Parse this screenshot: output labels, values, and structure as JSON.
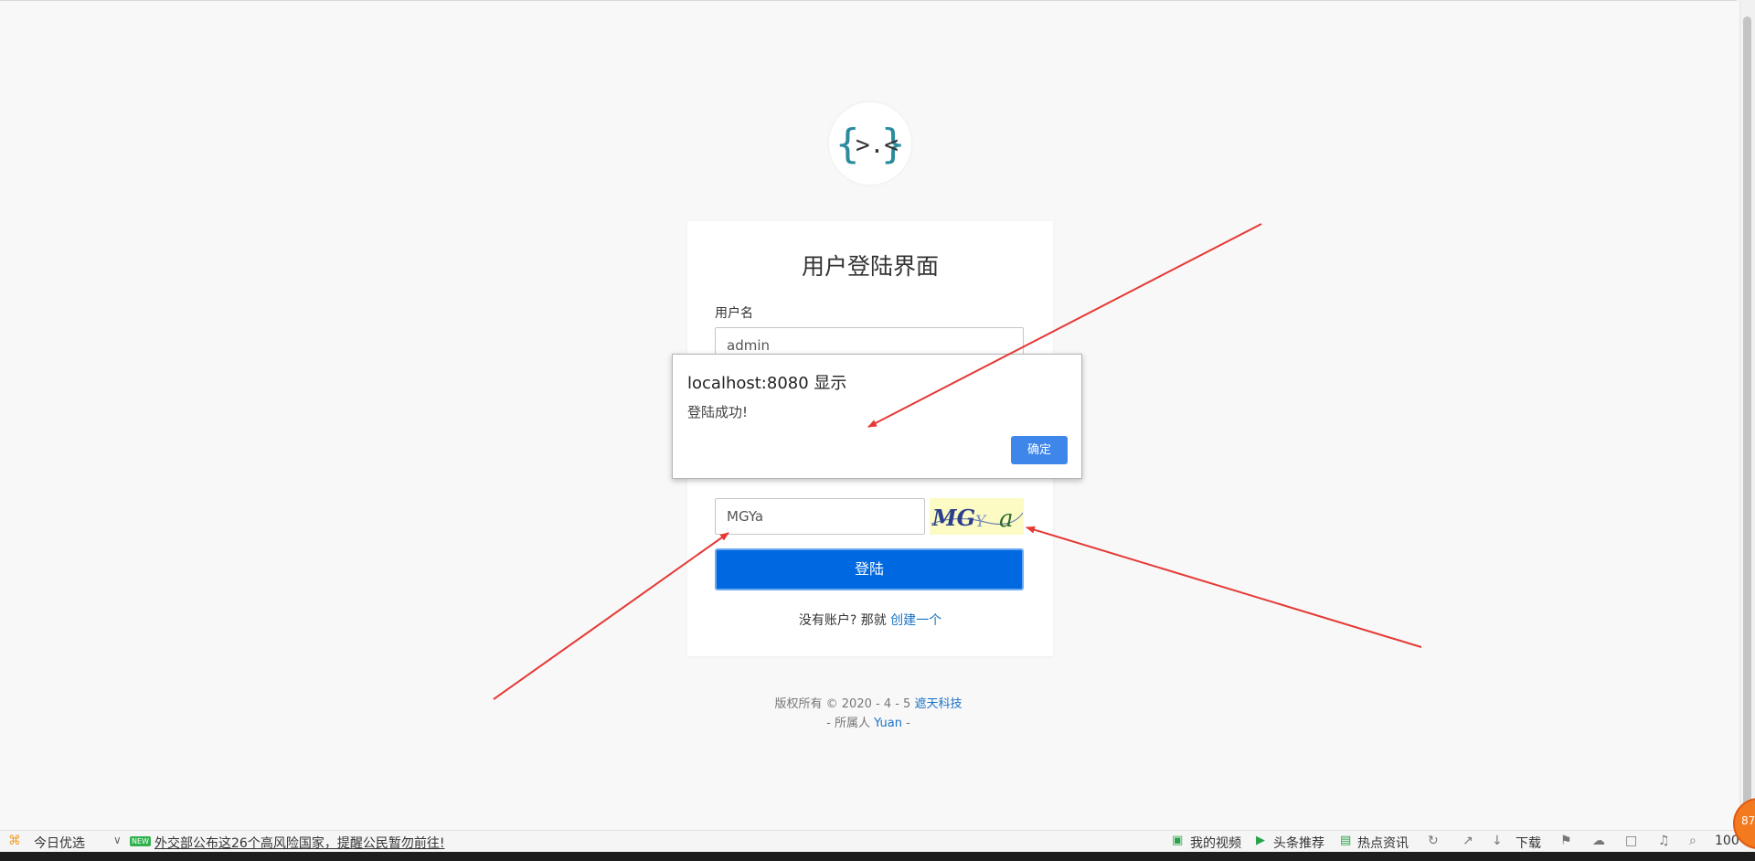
{
  "page": {
    "logo_text": "{>.<}",
    "card_title": "用户登陆界面",
    "username_label": "用户名",
    "username_value": "admin",
    "captcha_value": "MGYa",
    "captcha_image_text": "MGYa",
    "login_button": "登陆",
    "signup_prompt": "没有账户? 那就",
    "signup_link": "创建一个",
    "footer_copyright": "版权所有 © 2020 - 4 - 5",
    "footer_company": "遮天科技",
    "footer_owner_prefix": "- 所属人",
    "footer_owner": "Yuan",
    "footer_owner_suffix": "-"
  },
  "dialog": {
    "title": "localhost:8080 显示",
    "message": "登陆成功!",
    "ok_button": "确定"
  },
  "statusbar": {
    "today_pick": "今日优选",
    "new_badge": "NEW",
    "news_headline": "外交部公布这26个高风险国家，提醒公民暂勿前往!",
    "my_video": "我的视频",
    "headline_recommend": "头条推荐",
    "hot_news": "热点资讯",
    "download": "下载",
    "zoom": "100",
    "badge_number": "87"
  },
  "colors": {
    "primary_button": "#0068e0",
    "dialog_button": "#3f86ea",
    "link": "#1a73c5",
    "annotation_arrow": "#e53935",
    "logo_brace": "#2a8c9c"
  }
}
